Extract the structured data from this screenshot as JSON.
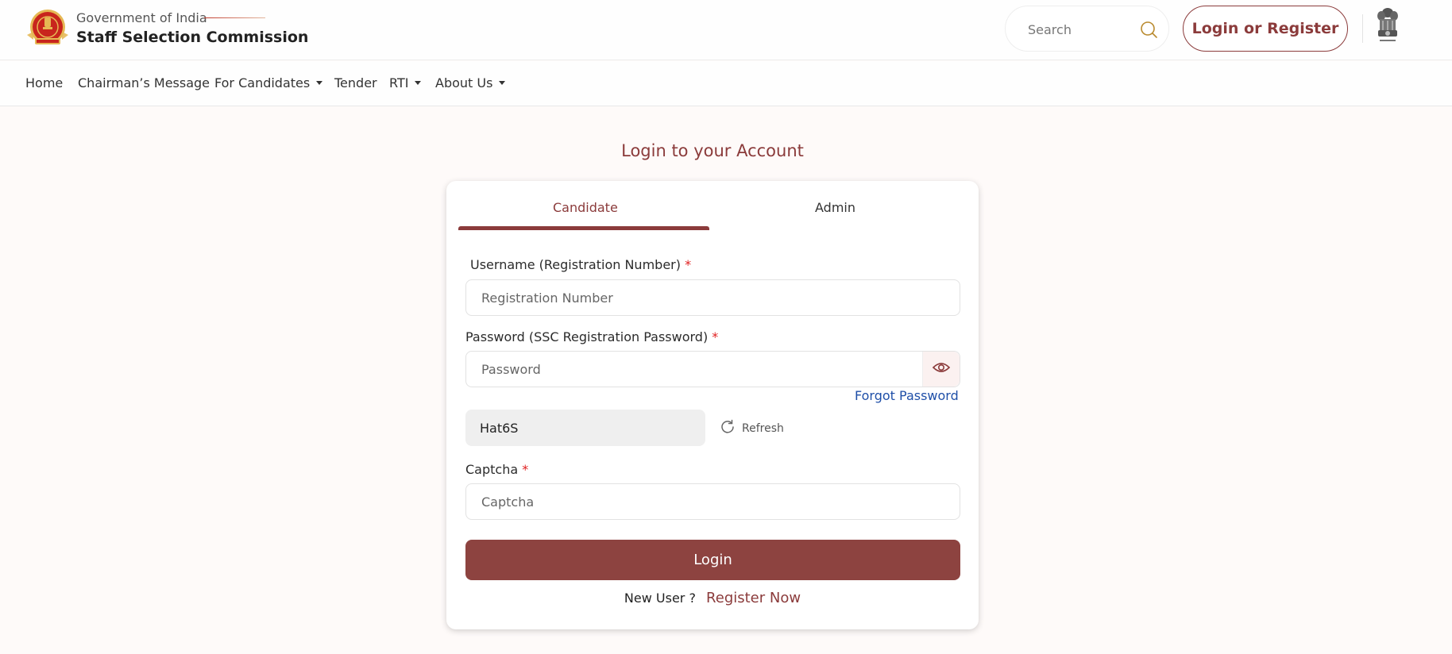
{
  "header": {
    "brand_top": "Government of India",
    "brand_main": "Staff Selection Commission",
    "search_placeholder": "Search",
    "login_register_label": "Login or Register",
    "logo_icon": "ssc-logo-icon",
    "emblem_icon": "national-emblem-icon"
  },
  "nav": {
    "items": [
      {
        "label": "Home",
        "dropdown": false
      },
      {
        "label": "Chairman’s Message",
        "dropdown": false
      },
      {
        "label": "For Candidates",
        "dropdown": true
      },
      {
        "label": "Tender",
        "dropdown": false
      },
      {
        "label": "RTI",
        "dropdown": true
      },
      {
        "label": "About Us",
        "dropdown": true
      }
    ]
  },
  "main": {
    "title": "Login to your Account",
    "tabs": [
      {
        "label": "Candidate",
        "active": true
      },
      {
        "label": "Admin",
        "active": false
      }
    ],
    "username": {
      "label": "Username (Registration Number)",
      "required_mark": "*",
      "placeholder": "Registration Number",
      "value": ""
    },
    "password": {
      "label": "Password (SSC Registration Password)",
      "required_mark": "*",
      "placeholder": "Password",
      "value": ""
    },
    "forgot_password_label": "Forgot Password",
    "captcha_code": "Hat6S",
    "refresh_label": "Refresh",
    "captcha": {
      "label": "Captcha",
      "required_mark": "*",
      "placeholder": "Captcha",
      "value": ""
    },
    "login_button_label": "Login",
    "new_user_text": "New User ?",
    "register_now_label": "Register Now"
  },
  "colors": {
    "brand": "#8b3b3b",
    "login_button": "#8d4340",
    "link_blue": "#1f4fa8",
    "required": "#e02020",
    "page_bg": "#fefaf9"
  }
}
